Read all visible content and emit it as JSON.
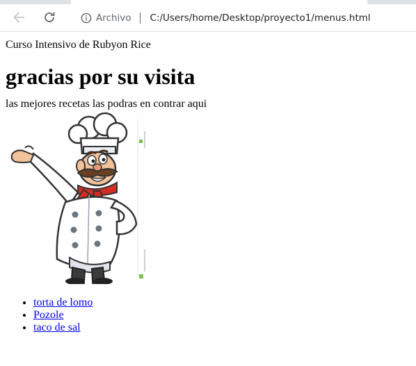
{
  "browser": {
    "security_label": "Archivo",
    "url": "C:/Users/home/Desktop/proyecto1/menus.html"
  },
  "page": {
    "site_title": "Curso Intensivo de Rubyon Rice",
    "heading": "gracias por su visita",
    "subtitle": "las mejores recetas las podras en contrar aqui",
    "menu_items": [
      {
        "label": "torta de lomo"
      },
      {
        "label": "Pozole"
      },
      {
        "label": "taco de sal"
      }
    ]
  },
  "colors": {
    "link": "#0000ee",
    "toolbar_border": "#dadce0",
    "icon": "#5f6368"
  },
  "icons": [
    "back-arrow-icon",
    "reload-icon",
    "info-icon",
    "chef-illustration"
  ]
}
